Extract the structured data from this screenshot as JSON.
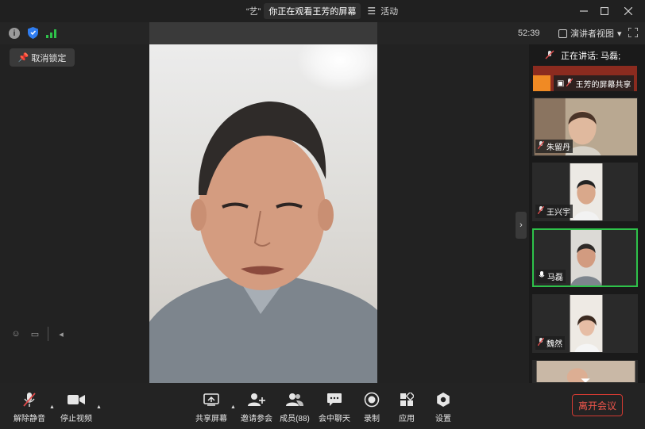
{
  "titlebar": {
    "quote": "“艺”",
    "sharing_text": "你正在观看王芳的屏幕",
    "activity": "活动"
  },
  "infobar": {
    "info_glyph": "i",
    "timer": "52:39",
    "view_mode": "演讲者视图"
  },
  "unlock_label": "取消锁定",
  "speaking": "正在讲话: 马磊;",
  "share_tile_label": "王芳的屏幕共享",
  "participants": [
    {
      "name": "朱留丹"
    },
    {
      "name": "王兴宇"
    },
    {
      "name": "马磊",
      "active": true
    },
    {
      "name": "魏然"
    }
  ],
  "toolbar": {
    "mute": "解除静音",
    "video": "停止视频",
    "share": "共享屏幕",
    "invite": "邀请参会",
    "members": "成员(88)",
    "chat": "会中聊天",
    "record": "录制",
    "apps": "应用",
    "settings": "设置",
    "leave": "离开会议"
  },
  "icons": {
    "caret": "▲",
    "collapse": "›",
    "back": "◂"
  },
  "colors": {
    "accent_green": "#2ec24a",
    "leave_red": "#f0564c",
    "background": "#1f1f1f"
  }
}
